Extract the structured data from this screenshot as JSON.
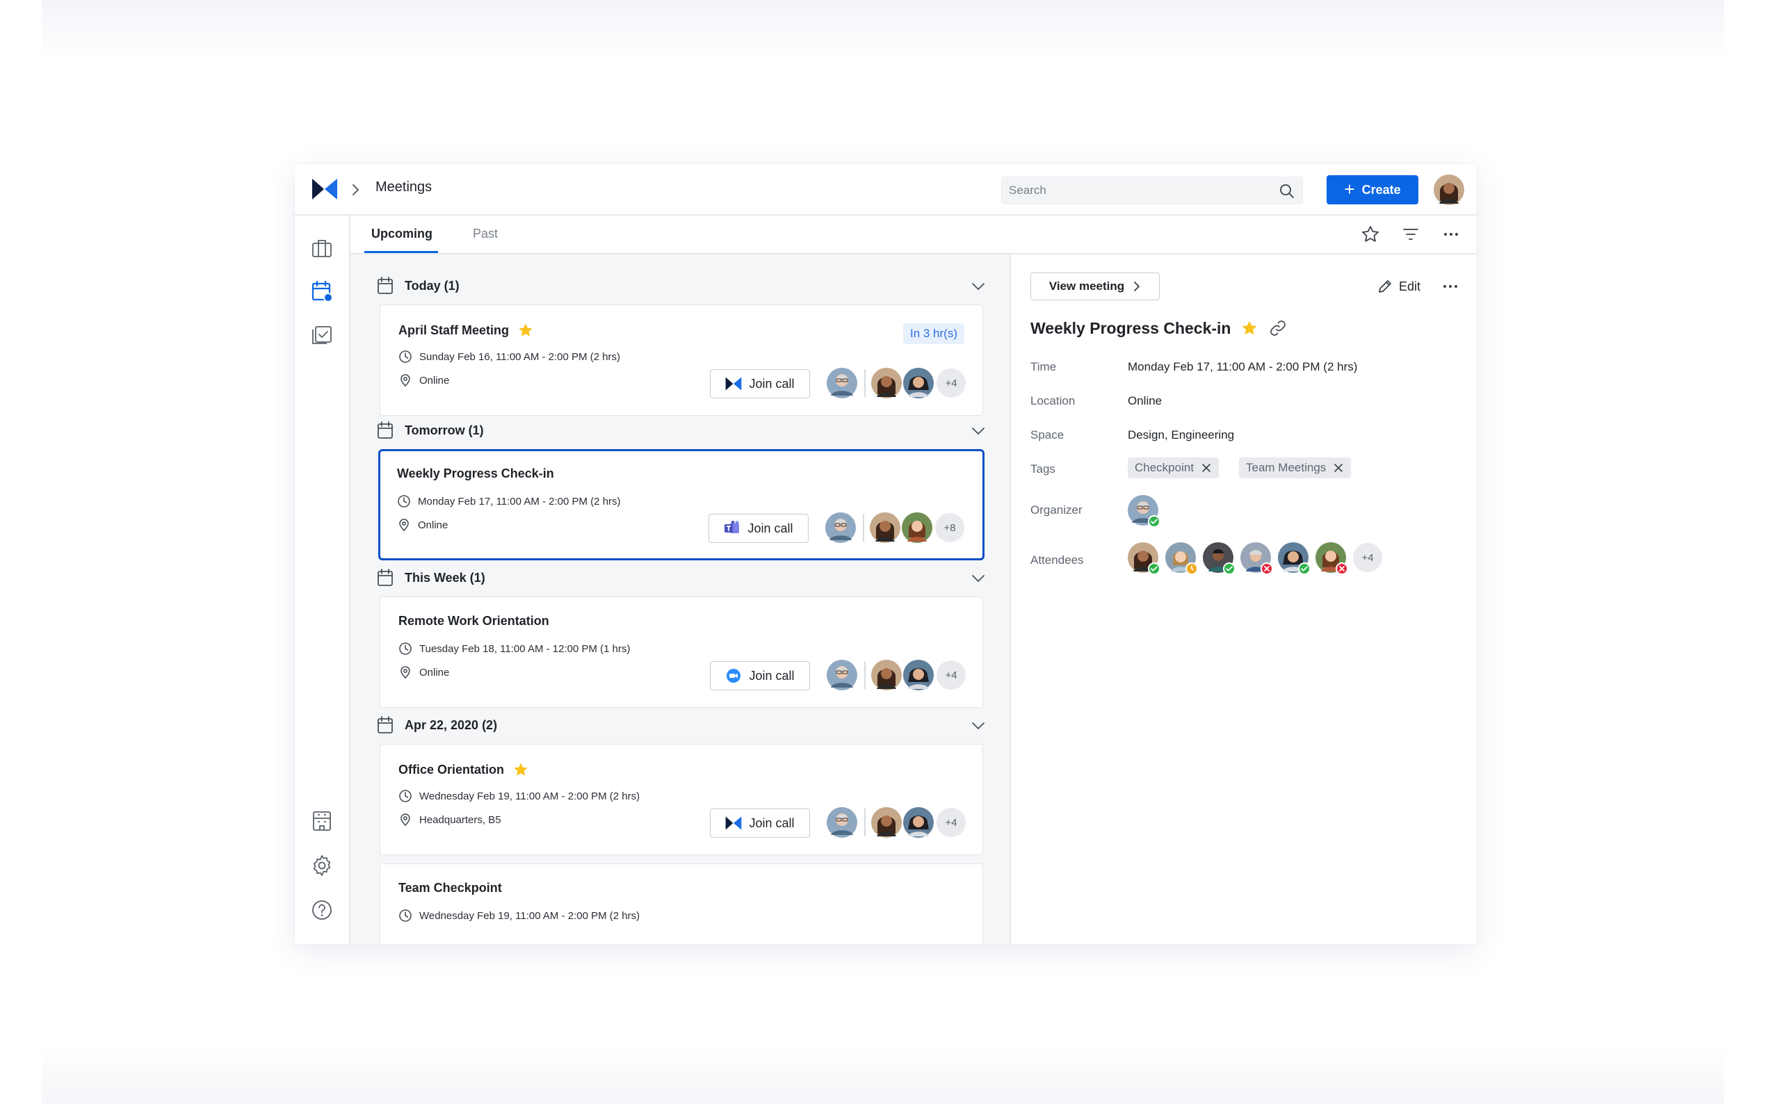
{
  "header": {
    "page_title": "Meetings",
    "search_placeholder": "Search",
    "create_label": "Create"
  },
  "tabs": [
    {
      "label": "Upcoming",
      "active": true
    },
    {
      "label": "Past",
      "active": false
    }
  ],
  "groups": [
    {
      "label": "Today (1)",
      "meetings": [
        {
          "title": "April Staff Meeting",
          "starred": true,
          "time": "Sunday Feb 16, 11:00 AM - 2:00 PM (2 hrs)",
          "location": "Online",
          "badge": "In 3 hr(s)",
          "join_label": "Join call",
          "provider_icon": "bluejeans-icon",
          "extra_attendees": "+4"
        }
      ]
    },
    {
      "label": "Tomorrow (1)",
      "meetings": [
        {
          "title": "Weekly Progress Check-in",
          "starred": false,
          "selected": true,
          "time": "Monday Feb 17, 11:00 AM - 2:00 PM (2 hrs)",
          "location": "Online",
          "join_label": "Join call",
          "provider_icon": "teams-icon",
          "extra_attendees": "+8"
        }
      ]
    },
    {
      "label": "This Week (1)",
      "meetings": [
        {
          "title": "Remote Work Orientation",
          "starred": false,
          "time": "Tuesday Feb 18, 11:00 AM - 12:00 PM (1 hrs)",
          "location": "Online",
          "join_label": "Join call",
          "provider_icon": "zoom-icon",
          "extra_attendees": "+4"
        }
      ]
    },
    {
      "label": "Apr 22, 2020 (2)",
      "meetings": [
        {
          "title": "Office Orientation",
          "starred": true,
          "time": "Wednesday Feb 19, 11:00 AM - 2:00 PM (2 hrs)",
          "location": "Headquarters, B5",
          "join_label": "Join call",
          "provider_icon": "bluejeans-icon",
          "extra_attendees": "+4"
        },
        {
          "title": "Team Checkpoint",
          "starred": false,
          "time": "Wednesday Feb 19, 11:00 AM - 2:00 PM (2 hrs)"
        }
      ]
    }
  ],
  "detail": {
    "view_label": "View meeting",
    "edit_label": "Edit",
    "title": "Weekly Progress Check-in",
    "starred": true,
    "fields": {
      "time_label": "Time",
      "time_value": "Monday Feb 17, 11:00 AM - 2:00 PM (2 hrs)",
      "location_label": "Location",
      "location_value": "Online",
      "space_label": "Space",
      "space_value": "Design, Engineering",
      "tags_label": "Tags",
      "organizer_label": "Organizer",
      "attendees_label": "Attendees"
    },
    "tags": [
      "Checkpoint",
      "Team Meetings"
    ],
    "attendee_statuses": [
      "accepted",
      "tentative",
      "accepted",
      "declined",
      "accepted",
      "declined"
    ],
    "extra_attendees": "+4"
  },
  "colors": {
    "accent": "#0b66e4",
    "selected_border": "#0b4fc7",
    "accepted": "#2eb34a",
    "tentative": "#f0a81c",
    "declined": "#e0263a",
    "star": "#f7c21a"
  }
}
